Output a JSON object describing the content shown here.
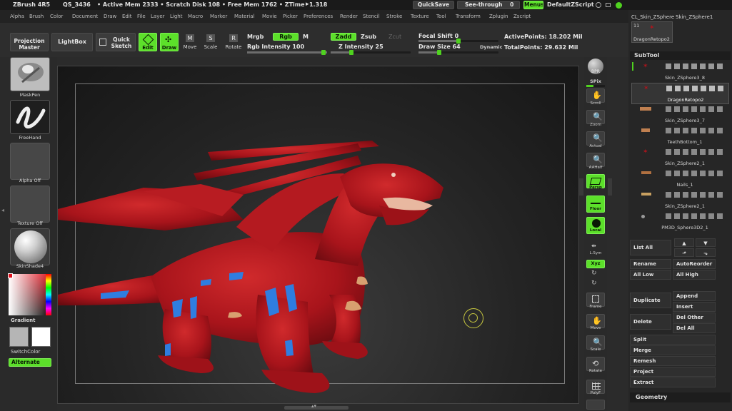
{
  "titlebar": {
    "app": "ZBrush 4R5",
    "qs": "QS_3436",
    "mem": "• Active Mem 2333 • Scratch Disk 108 • Free Mem 1762 • ZTime⯈1.318",
    "quicksave": "QuickSave",
    "seethrough": "See-through",
    "seethrough_value": "0",
    "menus": "Menus",
    "script": "DefaultZScript"
  },
  "menubar": [
    "Alpha",
    "Brush",
    "Color",
    "Document",
    "Draw",
    "Edit",
    "File",
    "Layer",
    "Light",
    "Macro",
    "Marker",
    "Material",
    "Movie",
    "Picker",
    "Preferences",
    "Render",
    "Stencil",
    "Stroke",
    "Texture",
    "Tool",
    "Transform",
    "Zplugin",
    "Zscript"
  ],
  "shelf": {
    "projection_master": "Projection Master",
    "lightbox": "LightBox",
    "quick_sketch": "Quick Sketch",
    "edit": "Edit",
    "draw": "Draw",
    "move": "Move",
    "scale": "Scale",
    "rotate": "Rotate",
    "mrgb": "Mrgb",
    "rgb": "Rgb",
    "m": "M",
    "rgb_intensity": "Rgb Intensity 100",
    "zadd": "Zadd",
    "zsub": "Zsub",
    "zcut": "Zcut",
    "z_intensity": "Z Intensity 25",
    "focal_shift": "Focal Shift 0",
    "draw_size": "Draw Size 64",
    "dynamic": "Dynamic",
    "active_points": "ActivePoints: 18.202 Mil",
    "total_points": "TotalPoints: 29.632 Mil"
  },
  "left": {
    "brush": "MaskPen",
    "stroke": "FreeHand",
    "alpha": "Alpha Off",
    "texture": "Texture Off",
    "material": "SkinShade4",
    "gradient": "Gradient",
    "switchcolor": "SwitchColor",
    "alternate": "Alternate"
  },
  "rightshelf": [
    "BPR",
    "SPix",
    "Scroll",
    "Zoom",
    "Actual",
    "AAHalf",
    "Persp",
    "Floor",
    "Local",
    "L.Sym",
    "Xyz",
    "Frame",
    "Move",
    "Scale",
    "Rotate",
    "PolyF"
  ],
  "toolpanel": {
    "tool1": "CL_Skin_ZSphere",
    "tool2": "Skin_ZSphere1",
    "count": "11",
    "tool3": "DragonRetopo2"
  },
  "subtool": {
    "header": "SubTool",
    "items": [
      "Skin_ZSphere3_8",
      "DragonRetopo2",
      "Skin_ZSphere3_7",
      "TeethBottom_1",
      "Skin_ZSphere2_1",
      "Nails_1",
      "Skin_ZSphere2_1",
      "PM3D_Sphere3D2_1"
    ],
    "list_all": "List All",
    "rename": "Rename",
    "autoreorder": "AutoReorder",
    "all_low": "All Low",
    "all_high": "All High",
    "duplicate": "Duplicate",
    "append": "Append",
    "insert": "Insert",
    "delete": "Delete",
    "del_other": "Del Other",
    "del_all": "Del All",
    "split": "Split",
    "merge": "Merge",
    "remesh": "Remesh",
    "project": "Project",
    "extract": "Extract",
    "geometry": "Geometry"
  },
  "colors": {
    "accent": "#5ce02a",
    "dragon": "#b0141c",
    "marking": "#2f7de0"
  }
}
